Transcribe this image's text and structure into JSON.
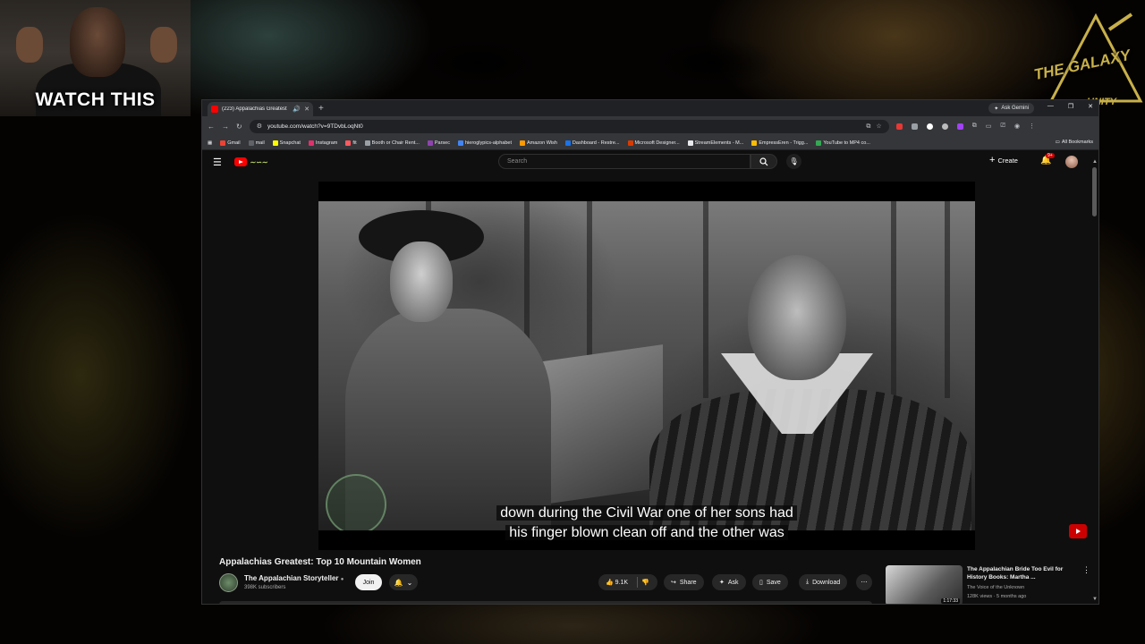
{
  "overlay": {
    "webcam_caption": "WATCH THIS",
    "logo_text_1": "THE GALAXY",
    "logo_text_2": "UNITY"
  },
  "browser": {
    "tab_title": "(223) Appalachias Greatest",
    "ask_gemini": "Ask Gemini",
    "url": "youtube.com/watch?v=9TDvbLoqNt0",
    "bookmarks": [
      {
        "label": "Gmail",
        "color": "#ea4335"
      },
      {
        "label": "mail",
        "color": "#5f6368"
      },
      {
        "label": "Snapchat",
        "color": "#fffc00"
      },
      {
        "label": "Instagram",
        "color": "#e1306c"
      },
      {
        "label": "fit",
        "color": "#ff5a5f"
      },
      {
        "label": "Booth or Chair Rent...",
        "color": "#9aa0a6"
      },
      {
        "label": "Parsec",
        "color": "#8e44ad"
      },
      {
        "label": "hieroglypics-alphabet",
        "color": "#4285f4"
      },
      {
        "label": "Amazon Wish",
        "color": "#ff9900"
      },
      {
        "label": "Dashboard - Restre...",
        "color": "#1a73e8"
      },
      {
        "label": "Microsoft Designer...",
        "color": "#d83b01"
      },
      {
        "label": "StreamElements - M...",
        "color": "#e8eaed"
      },
      {
        "label": "EmpressEren - Trigg...",
        "color": "#fbbc04"
      },
      {
        "label": "YouTube to MP4 co...",
        "color": "#34a853"
      }
    ],
    "all_bookmarks": "All Bookmarks"
  },
  "youtube": {
    "search_placeholder": "Search",
    "create_label": "Create",
    "notif_badge": "9+",
    "caption_line1": "down during the Civil War one of her sons had",
    "caption_line2": "his finger blown clean off and the other was",
    "video_title": "Appalachias Greatest: Top 10 Mountain Women",
    "channel_name": "The Appalachian Storyteller",
    "subscribers": "398K subscribers",
    "join_label": "Join",
    "likes": "9.1K",
    "share_label": "Share",
    "ask_label": "Ask",
    "save_label": "Save",
    "download_label": "Download",
    "recommended": {
      "title": "The Appalachian Bride Too Evil for History Books: Martha ...",
      "channel": "The Voice of the Unknown",
      "meta": "128K views · 5 months ago",
      "duration": "1:17:33"
    }
  }
}
